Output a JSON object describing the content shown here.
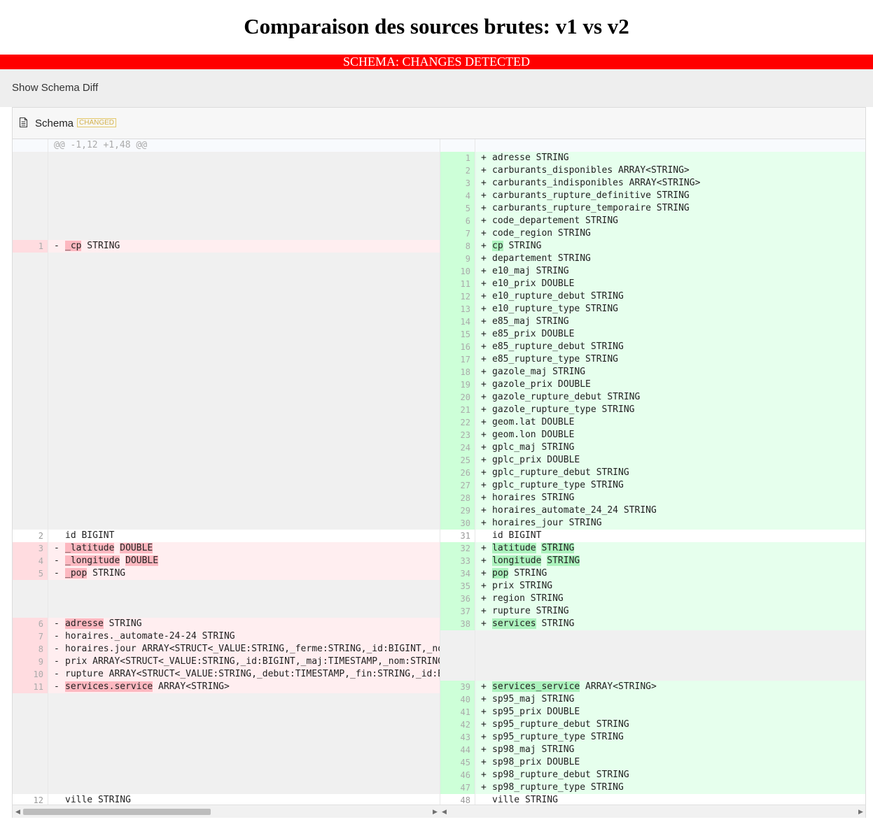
{
  "page": {
    "title": "Comparaison des sources brutes: v1 vs v2"
  },
  "banner": {
    "text": "SCHEMA: CHANGES DETECTED",
    "color": "#ff0000"
  },
  "toggle": {
    "label": "Show Schema Diff"
  },
  "file": {
    "name": "Schema",
    "badge": "CHANGED",
    "icon": "document-icon"
  },
  "colors": {
    "deleted_bg": "#ffeef0",
    "deleted_highlight": "#fdb8c0",
    "added_bg": "#e6ffed",
    "added_highlight": "#acf2bd",
    "empty_bg": "#f0f0f0"
  },
  "diff": {
    "hunk_header": "@@ -1,12 +1,48 @@",
    "left": [
      {
        "t": "empty"
      },
      {
        "t": "empty"
      },
      {
        "t": "empty"
      },
      {
        "t": "empty"
      },
      {
        "t": "empty"
      },
      {
        "t": "empty"
      },
      {
        "t": "empty"
      },
      {
        "t": "del",
        "n": "1",
        "parts": [
          {
            "s": "_cp",
            "h": 1
          },
          {
            "s": " STRING"
          }
        ]
      },
      {
        "t": "empty"
      },
      {
        "t": "empty"
      },
      {
        "t": "empty"
      },
      {
        "t": "empty"
      },
      {
        "t": "empty"
      },
      {
        "t": "empty"
      },
      {
        "t": "empty"
      },
      {
        "t": "empty"
      },
      {
        "t": "empty"
      },
      {
        "t": "empty"
      },
      {
        "t": "empty"
      },
      {
        "t": "empty"
      },
      {
        "t": "empty"
      },
      {
        "t": "empty"
      },
      {
        "t": "empty"
      },
      {
        "t": "empty"
      },
      {
        "t": "empty"
      },
      {
        "t": "empty"
      },
      {
        "t": "empty"
      },
      {
        "t": "empty"
      },
      {
        "t": "empty"
      },
      {
        "t": "empty"
      },
      {
        "t": "ctx",
        "n": "2",
        "parts": [
          {
            "s": "id BIGINT"
          }
        ]
      },
      {
        "t": "del",
        "n": "3",
        "parts": [
          {
            "s": "_latitude",
            "h": 1
          },
          {
            "s": " "
          },
          {
            "s": "DOUBLE",
            "h": 1
          }
        ]
      },
      {
        "t": "del",
        "n": "4",
        "parts": [
          {
            "s": "_longitude",
            "h": 1
          },
          {
            "s": " "
          },
          {
            "s": "DOUBLE",
            "h": 1
          }
        ]
      },
      {
        "t": "del",
        "n": "5",
        "parts": [
          {
            "s": "_pop",
            "h": 1
          },
          {
            "s": " STRING"
          }
        ]
      },
      {
        "t": "empty"
      },
      {
        "t": "empty"
      },
      {
        "t": "empty"
      },
      {
        "t": "del",
        "n": "6",
        "parts": [
          {
            "s": "adresse",
            "h": 1
          },
          {
            "s": " STRING"
          }
        ]
      },
      {
        "t": "del",
        "n": "7",
        "parts": [
          {
            "s": "horaires._automate-24-24 STRING"
          }
        ]
      },
      {
        "t": "del",
        "n": "8",
        "parts": [
          {
            "s": "horaires.jour ARRAY<STRUCT<_VALUE:STRING,_ferme:STRING,_id:BIGINT,_nom:STRING,ho"
          }
        ]
      },
      {
        "t": "del",
        "n": "9",
        "parts": [
          {
            "s": "prix ARRAY<STRUCT<_VALUE:STRING,_id:BIGINT,_maj:TIMESTAMP,_nom:STRING,_valeur:"
          }
        ]
      },
      {
        "t": "del",
        "n": "10",
        "parts": [
          {
            "s": "rupture ARRAY<STRUCT<_VALUE:STRING,_debut:TIMESTAMP,_fin:STRING,_id:BIGINT,_no"
          }
        ]
      },
      {
        "t": "del",
        "n": "11",
        "parts": [
          {
            "s": "services.service",
            "h": 1
          },
          {
            "s": " ARRAY<STRING>"
          }
        ]
      },
      {
        "t": "empty"
      },
      {
        "t": "empty"
      },
      {
        "t": "empty"
      },
      {
        "t": "empty"
      },
      {
        "t": "empty"
      },
      {
        "t": "empty"
      },
      {
        "t": "empty"
      },
      {
        "t": "empty"
      },
      {
        "t": "ctx",
        "n": "12",
        "parts": [
          {
            "s": "ville STRING"
          }
        ]
      }
    ],
    "right": [
      {
        "t": "add",
        "n": "1",
        "parts": [
          {
            "s": "adresse STRING"
          }
        ]
      },
      {
        "t": "add",
        "n": "2",
        "parts": [
          {
            "s": "carburants_disponibles ARRAY<STRING>"
          }
        ]
      },
      {
        "t": "add",
        "n": "3",
        "parts": [
          {
            "s": "carburants_indisponibles ARRAY<STRING>"
          }
        ]
      },
      {
        "t": "add",
        "n": "4",
        "parts": [
          {
            "s": "carburants_rupture_definitive STRING"
          }
        ]
      },
      {
        "t": "add",
        "n": "5",
        "parts": [
          {
            "s": "carburants_rupture_temporaire STRING"
          }
        ]
      },
      {
        "t": "add",
        "n": "6",
        "parts": [
          {
            "s": "code_departement STRING"
          }
        ]
      },
      {
        "t": "add",
        "n": "7",
        "parts": [
          {
            "s": "code_region STRING"
          }
        ]
      },
      {
        "t": "add",
        "n": "8",
        "parts": [
          {
            "s": "cp",
            "h": 1
          },
          {
            "s": " STRING"
          }
        ]
      },
      {
        "t": "add",
        "n": "9",
        "parts": [
          {
            "s": "departement STRING"
          }
        ]
      },
      {
        "t": "add",
        "n": "10",
        "parts": [
          {
            "s": "e10_maj STRING"
          }
        ]
      },
      {
        "t": "add",
        "n": "11",
        "parts": [
          {
            "s": "e10_prix DOUBLE"
          }
        ]
      },
      {
        "t": "add",
        "n": "12",
        "parts": [
          {
            "s": "e10_rupture_debut STRING"
          }
        ]
      },
      {
        "t": "add",
        "n": "13",
        "parts": [
          {
            "s": "e10_rupture_type STRING"
          }
        ]
      },
      {
        "t": "add",
        "n": "14",
        "parts": [
          {
            "s": "e85_maj STRING"
          }
        ]
      },
      {
        "t": "add",
        "n": "15",
        "parts": [
          {
            "s": "e85_prix DOUBLE"
          }
        ]
      },
      {
        "t": "add",
        "n": "16",
        "parts": [
          {
            "s": "e85_rupture_debut STRING"
          }
        ]
      },
      {
        "t": "add",
        "n": "17",
        "parts": [
          {
            "s": "e85_rupture_type STRING"
          }
        ]
      },
      {
        "t": "add",
        "n": "18",
        "parts": [
          {
            "s": "gazole_maj STRING"
          }
        ]
      },
      {
        "t": "add",
        "n": "19",
        "parts": [
          {
            "s": "gazole_prix DOUBLE"
          }
        ]
      },
      {
        "t": "add",
        "n": "20",
        "parts": [
          {
            "s": "gazole_rupture_debut STRING"
          }
        ]
      },
      {
        "t": "add",
        "n": "21",
        "parts": [
          {
            "s": "gazole_rupture_type STRING"
          }
        ]
      },
      {
        "t": "add",
        "n": "22",
        "parts": [
          {
            "s": "geom.lat DOUBLE"
          }
        ]
      },
      {
        "t": "add",
        "n": "23",
        "parts": [
          {
            "s": "geom.lon DOUBLE"
          }
        ]
      },
      {
        "t": "add",
        "n": "24",
        "parts": [
          {
            "s": "gplc_maj STRING"
          }
        ]
      },
      {
        "t": "add",
        "n": "25",
        "parts": [
          {
            "s": "gplc_prix DOUBLE"
          }
        ]
      },
      {
        "t": "add",
        "n": "26",
        "parts": [
          {
            "s": "gplc_rupture_debut STRING"
          }
        ]
      },
      {
        "t": "add",
        "n": "27",
        "parts": [
          {
            "s": "gplc_rupture_type STRING"
          }
        ]
      },
      {
        "t": "add",
        "n": "28",
        "parts": [
          {
            "s": "horaires STRING"
          }
        ]
      },
      {
        "t": "add",
        "n": "29",
        "parts": [
          {
            "s": "horaires_automate_24_24 STRING"
          }
        ]
      },
      {
        "t": "add",
        "n": "30",
        "parts": [
          {
            "s": "horaires_jour STRING"
          }
        ]
      },
      {
        "t": "ctx",
        "n": "31",
        "parts": [
          {
            "s": "id BIGINT"
          }
        ]
      },
      {
        "t": "add",
        "n": "32",
        "parts": [
          {
            "s": "latitude",
            "h": 1
          },
          {
            "s": " "
          },
          {
            "s": "STRING",
            "h": 1
          }
        ]
      },
      {
        "t": "add",
        "n": "33",
        "parts": [
          {
            "s": "longitude",
            "h": 1
          },
          {
            "s": " "
          },
          {
            "s": "STRING",
            "h": 1
          }
        ]
      },
      {
        "t": "add",
        "n": "34",
        "parts": [
          {
            "s": "pop",
            "h": 1
          },
          {
            "s": " STRING"
          }
        ]
      },
      {
        "t": "add",
        "n": "35",
        "parts": [
          {
            "s": "prix STRING"
          }
        ]
      },
      {
        "t": "add",
        "n": "36",
        "parts": [
          {
            "s": "region STRING"
          }
        ]
      },
      {
        "t": "add",
        "n": "37",
        "parts": [
          {
            "s": "rupture STRING"
          }
        ]
      },
      {
        "t": "add",
        "n": "38",
        "parts": [
          {
            "s": "services",
            "h": 1
          },
          {
            "s": " STRING"
          }
        ]
      },
      {
        "t": "empty"
      },
      {
        "t": "empty"
      },
      {
        "t": "empty"
      },
      {
        "t": "empty"
      },
      {
        "t": "add",
        "n": "39",
        "parts": [
          {
            "s": "services_service",
            "h": 1
          },
          {
            "s": " ARRAY<STRING>"
          }
        ]
      },
      {
        "t": "add",
        "n": "40",
        "parts": [
          {
            "s": "sp95_maj STRING"
          }
        ]
      },
      {
        "t": "add",
        "n": "41",
        "parts": [
          {
            "s": "sp95_prix DOUBLE"
          }
        ]
      },
      {
        "t": "add",
        "n": "42",
        "parts": [
          {
            "s": "sp95_rupture_debut STRING"
          }
        ]
      },
      {
        "t": "add",
        "n": "43",
        "parts": [
          {
            "s": "sp95_rupture_type STRING"
          }
        ]
      },
      {
        "t": "add",
        "n": "44",
        "parts": [
          {
            "s": "sp98_maj STRING"
          }
        ]
      },
      {
        "t": "add",
        "n": "45",
        "parts": [
          {
            "s": "sp98_prix DOUBLE"
          }
        ]
      },
      {
        "t": "add",
        "n": "46",
        "parts": [
          {
            "s": "sp98_rupture_debut STRING"
          }
        ]
      },
      {
        "t": "add",
        "n": "47",
        "parts": [
          {
            "s": "sp98_rupture_type STRING"
          }
        ]
      },
      {
        "t": "ctx",
        "n": "48",
        "parts": [
          {
            "s": "ville STRING"
          }
        ]
      }
    ]
  }
}
